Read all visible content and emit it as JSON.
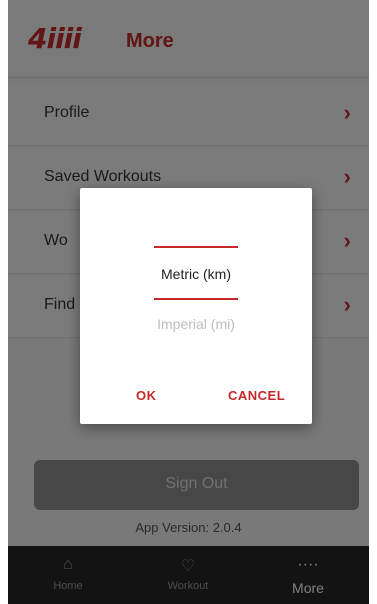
{
  "header": {
    "logo_text": "4iiii",
    "title": "More"
  },
  "menu": {
    "items": [
      {
        "label": "Profile"
      },
      {
        "label": "Saved Workouts"
      },
      {
        "label": "Wo"
      },
      {
        "label": "Find"
      }
    ]
  },
  "signout_label": "Sign Out",
  "app_version": "App Version: 2.0.4",
  "tabs": [
    {
      "label": "Home",
      "icon": "home-icon"
    },
    {
      "label": "Workout",
      "icon": "workout-icon"
    },
    {
      "label": "More",
      "icon": "more-dots-icon"
    }
  ],
  "dialog": {
    "options": [
      "Metric (km)",
      "Imperial (mi)"
    ],
    "selected": "Metric (km)",
    "ok_label": "OK",
    "cancel_label": "CANCEL"
  },
  "colors": {
    "accent": "#c62828",
    "tabbar": "#262626",
    "signout": "#8f8f8f"
  }
}
